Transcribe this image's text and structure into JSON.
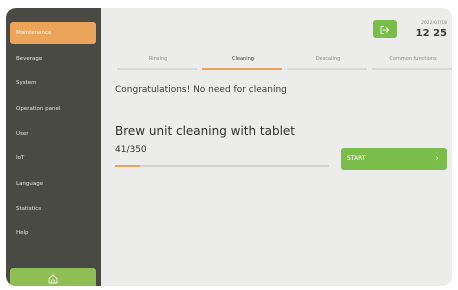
{
  "sidebar": {
    "items": [
      {
        "label": "Maintenance",
        "active": true
      },
      {
        "label": "Beverage",
        "active": false
      },
      {
        "label": "System",
        "active": false
      },
      {
        "label": "Operation panel",
        "active": false
      },
      {
        "label": "User",
        "active": false
      },
      {
        "label": "IoT",
        "active": false
      },
      {
        "label": "Language",
        "active": false
      },
      {
        "label": "Statistics",
        "active": false
      },
      {
        "label": "Help",
        "active": false
      }
    ],
    "home_icon": "home-icon"
  },
  "header": {
    "exit_icon": "exit-icon",
    "date": "2022/07/18",
    "time": "12 25"
  },
  "tabs": [
    {
      "label": "Rinsing",
      "active": false
    },
    {
      "label": "Cleaning",
      "active": true
    },
    {
      "label": "Descaling",
      "active": false
    },
    {
      "label": "Common functions",
      "active": false
    }
  ],
  "main": {
    "message": "Congratulations! No need for cleaning",
    "heading": "Brew unit cleaning with tablet",
    "counter": "41/350",
    "progress": 0.117,
    "start_label": "START"
  },
  "colors": {
    "accent": "#eba45a",
    "green": "#7bbd4b",
    "sidebar": "#4a4a45"
  }
}
